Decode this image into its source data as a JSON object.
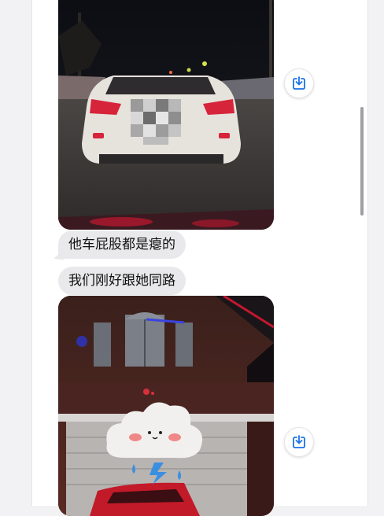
{
  "conversation": {
    "messages": [
      {
        "type": "image",
        "subject": "white sedan photographed at night"
      },
      {
        "type": "text",
        "text": "他车屁股都是瘪的"
      },
      {
        "type": "text",
        "text": "我们刚好跟她同路"
      },
      {
        "type": "image",
        "subject": "house with cloud sticker at night"
      }
    ]
  },
  "icons": {
    "save": "download-icon",
    "cloud_sticker": "cloud-sticker-icon"
  },
  "colors": {
    "accent": "#1a73e8",
    "incoming_bubble": "#e9e9eb",
    "panel_bg": "#ffffff",
    "page_bg": "#f2f2f4"
  }
}
